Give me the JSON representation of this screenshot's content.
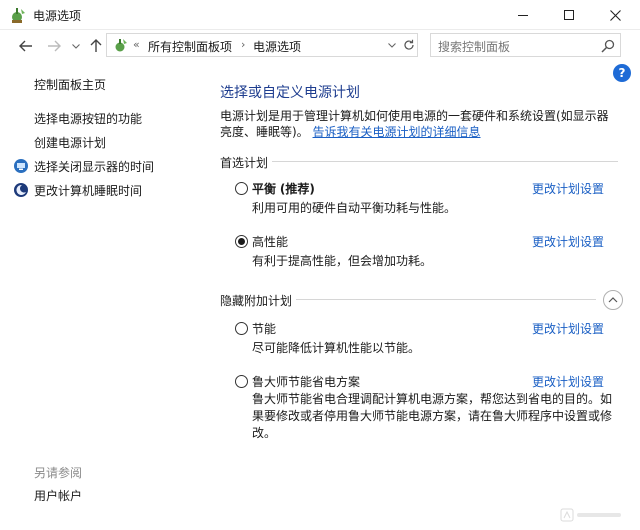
{
  "window": {
    "title": "电源选项",
    "minimize_icon": "minimize-icon",
    "maximize_icon": "maximize-icon",
    "close_icon": "close-icon"
  },
  "nav": {
    "back_icon": "back-arrow-icon",
    "forward_icon": "forward-arrow-icon",
    "up_icon": "up-arrow-icon",
    "breadcrumb_prefix": "«",
    "breadcrumbs": [
      "所有控制面板项",
      "电源选项"
    ],
    "breadcrumb_separator": "›",
    "refresh_icon": "refresh-icon",
    "search_placeholder": "搜索控制面板"
  },
  "help_label": "?",
  "sidebar": {
    "home": "控制面板主页",
    "items": [
      {
        "label": "选择电源按钮的功能",
        "icon": ""
      },
      {
        "label": "创建电源计划",
        "icon": ""
      },
      {
        "label": "选择关闭显示器的时间",
        "icon": "monitor-icon"
      },
      {
        "label": "更改计算机睡眠时间",
        "icon": "moon-icon"
      }
    ],
    "see_also": "另请参阅",
    "see_also_items": [
      "用户帐户"
    ]
  },
  "main": {
    "title": "选择或自定义电源计划",
    "description": "电源计划是用于管理计算机如何使用电源的一套硬件和系统设置(如显示器亮度、睡眠等)。",
    "description_link": "告诉我有关电源计划的详细信息",
    "preferred_label": "首选计划",
    "hidden_label": "隐藏附加计划",
    "change_link": "更改计划设置",
    "plans": [
      {
        "name": "平衡",
        "tag": "(推荐)",
        "desc": "利用可用的硬件自动平衡功耗与性能。",
        "selected": false
      },
      {
        "name": "高性能",
        "tag": "",
        "desc": "有利于提高性能，但会增加功耗。",
        "selected": true
      },
      {
        "name": "节能",
        "tag": "",
        "desc": "尽可能降低计算机性能以节能。",
        "selected": false
      },
      {
        "name": "鲁大师节能省电方案",
        "tag": "",
        "desc": "鲁大师节能省电合理调配计算机电源方案，帮您达到省电的目的。如果要修改或者停用鲁大师节能电源方案，请在鲁大师程序中设置或修改。",
        "selected": false
      }
    ]
  },
  "colors": {
    "link": "#1a5fc4",
    "title": "#1e3d8f",
    "help_bg": "#1e6bd6"
  }
}
